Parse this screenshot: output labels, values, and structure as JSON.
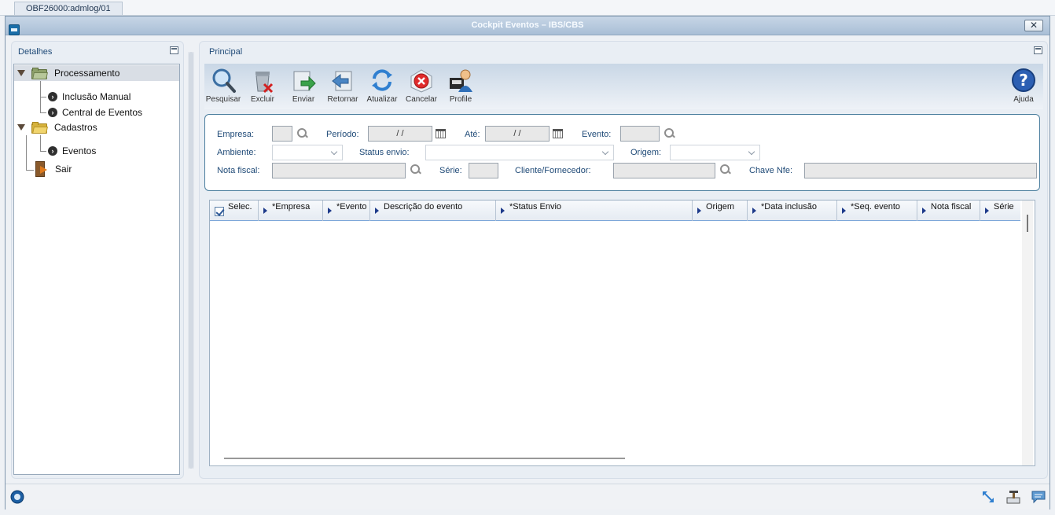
{
  "session_tab": "OBF26000:admlog/01",
  "window": {
    "title": "Cockpit Eventos – IBS/CBS"
  },
  "left_panel": {
    "title": "Detalhes",
    "tree": [
      {
        "label": "Processamento"
      },
      {
        "label": "Inclusão Manual"
      },
      {
        "label": "Central de Eventos"
      },
      {
        "label": "Cadastros"
      },
      {
        "label": "Eventos"
      },
      {
        "label": "Sair"
      }
    ]
  },
  "main_panel": {
    "title": "Principal",
    "toolbar": {
      "pesquisar": "Pesquisar",
      "excluir": "Excluir",
      "enviar": "Enviar",
      "retornar": "Retornar",
      "atualizar": "Atualizar",
      "cancelar": "Cancelar",
      "profile": "Profile",
      "ajuda": "Ajuda"
    },
    "filters": {
      "empresa": "Empresa:",
      "periodo": "Período:",
      "periodo_value": "/ /",
      "ate": "Até:",
      "ate_value": "/ /",
      "evento": "Evento:",
      "ambiente": "Ambiente:",
      "status_envio": "Status envio:",
      "origem": "Origem:",
      "nota_fiscal": "Nota fiscal:",
      "serie": "Série:",
      "cliente_fornecedor": "Cliente/Fornecedor:",
      "chave_nfe": "Chave Nfe:"
    },
    "grid": {
      "columns": [
        "Selec.",
        "*Empresa",
        "*Evento",
        "Descrição do evento",
        "*Status Envio",
        "Origem",
        "*Data inclusão",
        "*Seq. evento",
        "Nota fiscal",
        "Série"
      ]
    }
  },
  "colors": {
    "accent": "#1f4a77",
    "titlebar": "#a9bfd6"
  }
}
